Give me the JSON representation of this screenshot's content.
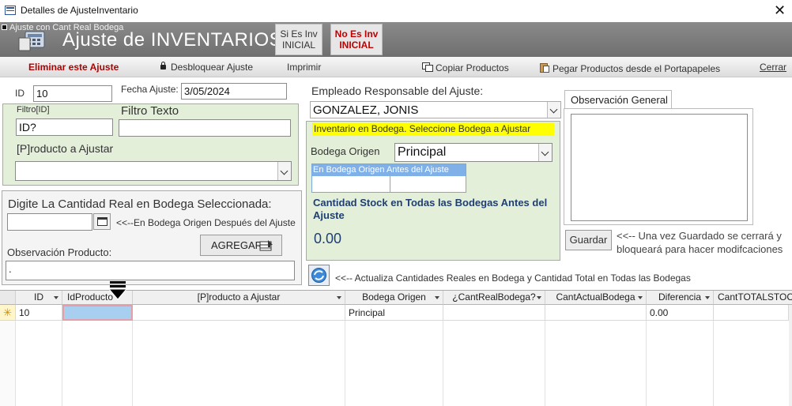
{
  "window": {
    "title": "Detalles de AjusteInventario",
    "close_symbol": "✕"
  },
  "header": {
    "caption": "Ajuste con Cant Real Bodega",
    "title": "Ajuste de INVENTARIOS",
    "btn_si": "Si Es Inv INICIAL",
    "btn_no": "No Es Inv INICIAL"
  },
  "toolbar": {
    "eliminar": "Eliminar este Ajuste",
    "desbloquear": "Desbloquear Ajuste",
    "imprimir": "Imprimir",
    "copiar": "Copiar Productos",
    "pegar": "Pegar Productos desde el Portapapeles",
    "cerrar": "Cerrar"
  },
  "form": {
    "id_label": "ID",
    "id_value": "10",
    "fecha_label": "Fecha Ajuste:",
    "fecha_value": "3/05/2024",
    "empleado_label": "Empleado Responsable del Ajuste:",
    "empleado_value": "GONZALEZ, JONIS",
    "filtro_id_label": "Filtro[ID]",
    "filtro_id_value": "ID?",
    "filtro_texto_label": "Filtro Texto",
    "filtro_texto_value": "",
    "producto_label": "[P]roducto a Ajustar",
    "producto_value": "",
    "digite_label": "Digite La Cantidad Real en Bodega Seleccionada:",
    "cantidad_value": "",
    "despues_label": "<<--En Bodega Origen Después del Ajuste",
    "agregar_label": "AGREGAR",
    "obs_prod_label": "Observación Producto:",
    "obs_prod_value": "."
  },
  "bodega": {
    "banner": "Inventario en Bodega. Seleccione Bodega a Ajustar",
    "origen_label": "Bodega Origen",
    "origen_value": "Principal",
    "antes_label": "En Bodega Origen Antes del Ajuste",
    "stock_label": "Cantidad Stock en Todas las Bodegas Antes del Ajuste",
    "stock_value": "0.00",
    "refresh_note": "<<-- Actualiza Cantidades Reales en Bodega y Cantidad Total en Todas las Bodegas"
  },
  "observacion": {
    "tab": "Observación General",
    "value": "",
    "guardar": "Guardar",
    "guardar_note": "<<-- Una vez Guardado se cerrará y bloqueará para hacer modifcaciones"
  },
  "grid": {
    "columns": [
      "ID",
      "IdProducto",
      "[P]roducto a Ajustar",
      "Bodega Origen",
      "¿CantRealBodega?",
      "CantActualBodega",
      "Diferencia",
      "CantTOTALSTOCK"
    ],
    "new_row_marker": "✳",
    "rows": [
      {
        "id": "10",
        "idproducto": "",
        "producto": "",
        "bodega": "Principal",
        "cantreal": "",
        "cantactual": "",
        "diferencia": "0.00",
        "total": ""
      }
    ]
  },
  "colors": {
    "banner_yellow": "#ffff00",
    "panel_green": "#e3efd9",
    "header_gray": "#7d7d7d",
    "danger_red": "#c00000",
    "selected_cell": "#a8cff0"
  }
}
